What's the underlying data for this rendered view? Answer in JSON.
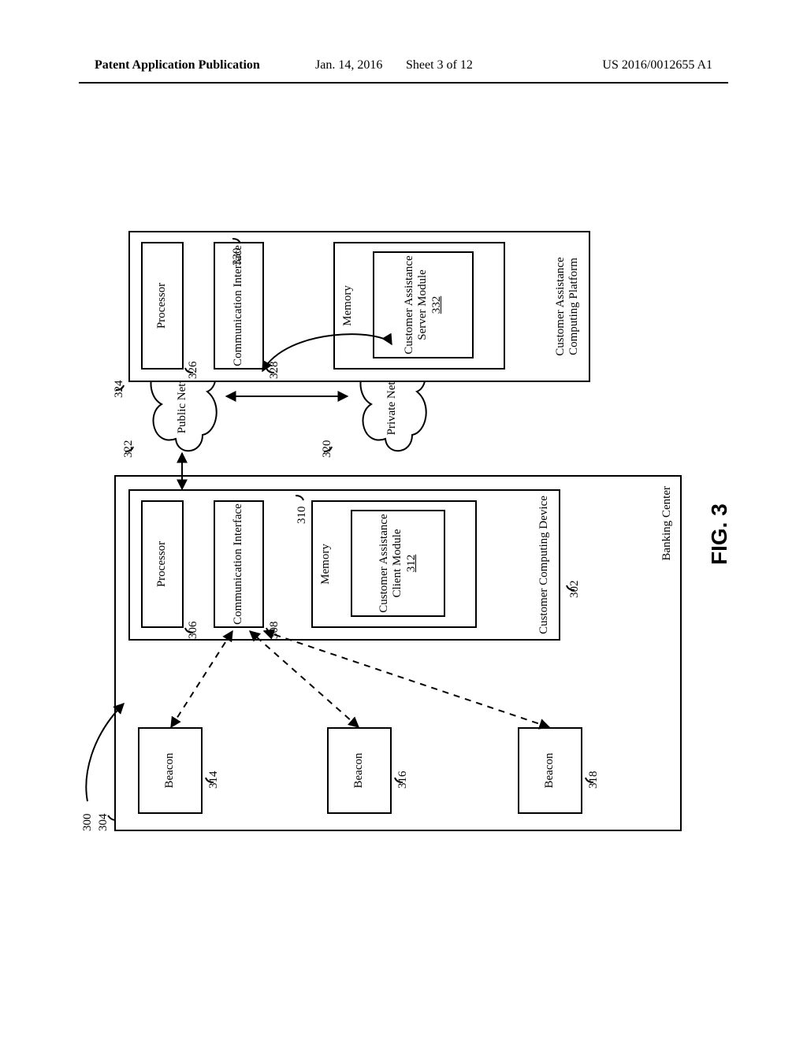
{
  "header": {
    "left": "Patent Application Publication",
    "date": "Jan. 14, 2016",
    "sheet": "Sheet 3 of 12",
    "pubno": "US 2016/0012655 A1"
  },
  "fig": {
    "caption": "FIG. 3",
    "system_ref": "300",
    "banking_center": {
      "label": "Banking Center",
      "ref": "304"
    },
    "beacons": [
      {
        "label": "Beacon",
        "ref": "314"
      },
      {
        "label": "Beacon",
        "ref": "316"
      },
      {
        "label": "Beacon",
        "ref": "318"
      }
    ],
    "customer_device": {
      "label": "Customer Computing Device",
      "ref": "302",
      "processor": {
        "label": "Processor",
        "ref": "306"
      },
      "comm": {
        "label": "Communication Interface",
        "ref": "308"
      },
      "memory": {
        "label": "Memory",
        "ref": "310",
        "module": {
          "label": "Customer Assistance Client Module",
          "ref": "312"
        }
      }
    },
    "networks": {
      "public": {
        "label": "Public Network",
        "ref": "322"
      },
      "private": {
        "label": "Private Network",
        "ref": "320"
      }
    },
    "platform": {
      "label": "Customer Assistance Computing Platform",
      "ref": "324",
      "processor": {
        "label": "Processor",
        "ref": "326"
      },
      "comm": {
        "label": "Communication Interface",
        "ref": "328"
      },
      "memory": {
        "label": "Memory",
        "ref": "330",
        "module": {
          "label": "Customer Assistance Server Module",
          "ref": "332"
        }
      }
    }
  }
}
